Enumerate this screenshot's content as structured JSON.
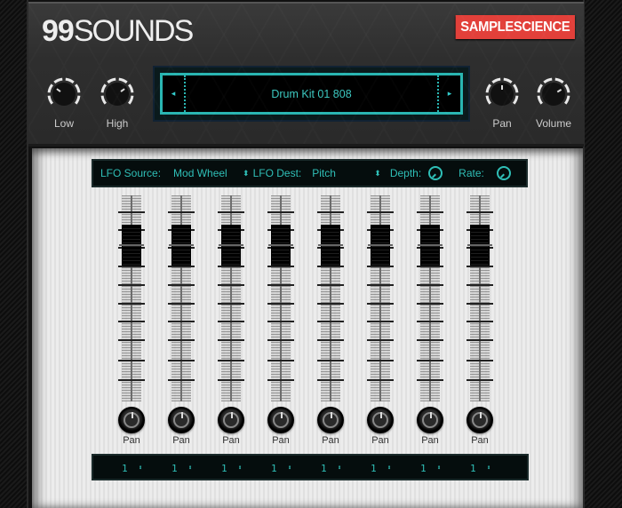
{
  "header": {
    "logo_number": "99",
    "logo_word": "SOUNDS",
    "brand": "SAMPLESCIENCE",
    "knobs": [
      {
        "label": "Low",
        "value": 0.3
      },
      {
        "label": "High",
        "value": 0.7
      },
      {
        "label": "Pan",
        "value": 0.5
      },
      {
        "label": "Volume",
        "value": 0.72
      }
    ],
    "preset": {
      "name": "Drum Kit 01 808",
      "prev_icon": "◂",
      "next_icon": "▸"
    }
  },
  "lfo": {
    "source_label": "LFO Source:",
    "source_value": "Mod Wheel",
    "dest_label": "LFO Dest:",
    "dest_value": "Pitch",
    "depth_label": "Depth:",
    "rate_label": "Rate:",
    "spin_icon": "⬍"
  },
  "channels": [
    {
      "pan_label": "Pan",
      "fader_value": 0.82,
      "output": "1",
      "arrows": "⬍"
    },
    {
      "pan_label": "Pan",
      "fader_value": 0.82,
      "output": "1",
      "arrows": "⬍"
    },
    {
      "pan_label": "Pan",
      "fader_value": 0.82,
      "output": "1",
      "arrows": "⬍"
    },
    {
      "pan_label": "Pan",
      "fader_value": 0.82,
      "output": "1",
      "arrows": "⬍"
    },
    {
      "pan_label": "Pan",
      "fader_value": 0.82,
      "output": "1",
      "arrows": "⬍"
    },
    {
      "pan_label": "Pan",
      "fader_value": 0.82,
      "output": "1",
      "arrows": "⬍"
    },
    {
      "pan_label": "Pan",
      "fader_value": 0.82,
      "output": "1",
      "arrows": "⬍"
    },
    {
      "pan_label": "Pan",
      "fader_value": 0.82,
      "output": "1",
      "arrows": "⬍"
    }
  ],
  "colors": {
    "accent": "#2fbfb7",
    "brand": "#e2403a"
  }
}
